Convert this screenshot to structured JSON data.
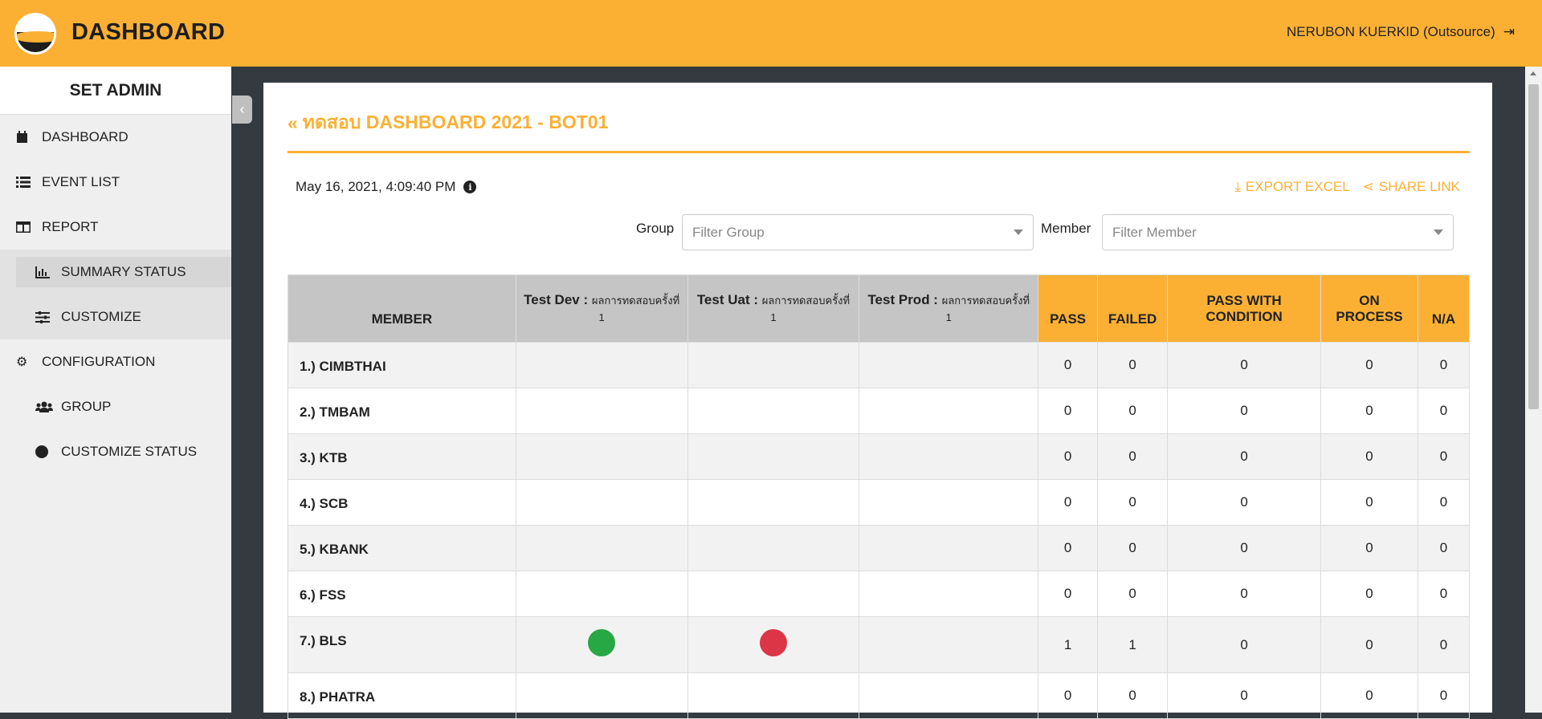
{
  "app": {
    "title": "DASHBOARD",
    "user": "NERUBON KUERKID (Outsource)"
  },
  "sidebar": {
    "header": "SET ADMIN",
    "items": [
      {
        "label": "DASHBOARD",
        "icon": "calendar-icon"
      },
      {
        "label": "EVENT LIST",
        "icon": "list-icon"
      },
      {
        "label": "REPORT",
        "icon": "table-icon"
      },
      {
        "label": "SUMMARY STATUS",
        "icon": "bar-chart-icon"
      },
      {
        "label": "CUSTOMIZE",
        "icon": "sliders-icon"
      },
      {
        "label": "CONFIGURATION",
        "icon": "gear-icon"
      },
      {
        "label": "GROUP",
        "icon": "users-icon"
      },
      {
        "label": "CUSTOMIZE STATUS",
        "icon": "circle-icon"
      }
    ]
  },
  "page": {
    "title": "ทดสอบ DASHBOARD 2021 - BOT01",
    "timestamp": "May 16, 2021, 4:09:40 PM",
    "export_label": "EXPORT EXCEL",
    "share_label": "SHARE LINK"
  },
  "filters": {
    "group_label": "Group",
    "group_placeholder": "Filter Group",
    "member_label": "Member",
    "member_placeholder": "Filter Member"
  },
  "table": {
    "headers": {
      "member": "MEMBER",
      "dev_bold": "Test Dev :",
      "dev_small": "ผลการทดสอบครั้งที่ 1",
      "uat_bold": "Test Uat :",
      "uat_small": "ผลการทดสอบครั้งที่ 1",
      "prod_bold": "Test Prod :",
      "prod_small": "ผลการทดสอบครั้งที่ 1",
      "pass": "PASS",
      "failed": "FAILED",
      "pass_with_condition": "PASS WITH CONDITION",
      "on_process": "ON PROCESS",
      "na": "N/A"
    },
    "rows": [
      {
        "name": "1.) CIMBTHAI",
        "pass": "0",
        "failed": "0",
        "pwc": "0",
        "onp": "0",
        "na": "0"
      },
      {
        "name": "2.) TMBAM",
        "pass": "0",
        "failed": "0",
        "pwc": "0",
        "onp": "0",
        "na": "0"
      },
      {
        "name": "3.) KTB",
        "pass": "0",
        "failed": "0",
        "pwc": "0",
        "onp": "0",
        "na": "0"
      },
      {
        "name": "4.) SCB",
        "pass": "0",
        "failed": "0",
        "pwc": "0",
        "onp": "0",
        "na": "0"
      },
      {
        "name": "5.) KBANK",
        "pass": "0",
        "failed": "0",
        "pwc": "0",
        "onp": "0",
        "na": "0"
      },
      {
        "name": "6.) FSS",
        "pass": "0",
        "failed": "0",
        "pwc": "0",
        "onp": "0",
        "na": "0"
      },
      {
        "name": "7.) BLS",
        "pass": "1",
        "failed": "1",
        "pwc": "0",
        "onp": "0",
        "na": "0",
        "dev_status": "pass",
        "uat_status": "failed"
      },
      {
        "name": "8.) PHATRA",
        "pass": "0",
        "failed": "0",
        "pwc": "0",
        "onp": "0",
        "na": "0"
      }
    ]
  },
  "colors": {
    "accent": "#fbb034",
    "status_pass": "#28a745",
    "status_failed": "#dc3545"
  }
}
